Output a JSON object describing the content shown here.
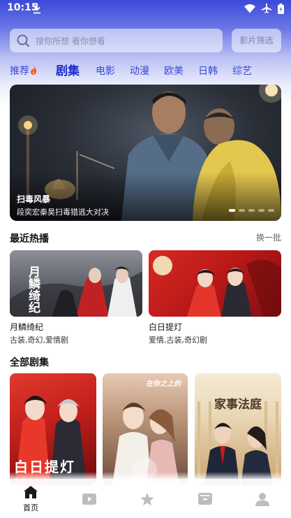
{
  "status_bar": {
    "time": "10:15"
  },
  "search": {
    "placeholder": "搜你所想 看你想看",
    "filter_label": "影片筛选"
  },
  "tabs": [
    {
      "label": "推荐"
    },
    {
      "label": "剧集"
    },
    {
      "label": "电影"
    },
    {
      "label": "动漫"
    },
    {
      "label": "欧美"
    },
    {
      "label": "日韩"
    },
    {
      "label": "综艺"
    }
  ],
  "active_tab": "剧集",
  "banner": {
    "title": "扫毒风暴",
    "subtitle": "段奕宏秦昊扫毒猎逃大对决",
    "page_count": 5,
    "current_page": 1
  },
  "recent": {
    "title": "最近热播",
    "action": "换一批",
    "items": [
      {
        "title": "月鳞绮纪",
        "tags": "古装,奇幻,爱情剧",
        "poster_text": "月鳞绮纪"
      },
      {
        "title": "白日提灯",
        "tags": "爱情,古装,奇幻剧"
      }
    ]
  },
  "all_series": {
    "title": "全部剧集",
    "items": [
      {
        "poster_text": "白日提灯"
      },
      {
        "poster_text": "在你之上的"
      },
      {
        "poster_text": "家事法庭"
      }
    ]
  },
  "bottom_nav": [
    {
      "label": "首页",
      "icon": "home-icon",
      "active": true
    },
    {
      "label": "",
      "icon": "video-icon"
    },
    {
      "label": "",
      "icon": "star-icon"
    },
    {
      "label": "",
      "icon": "folder-icon"
    },
    {
      "label": "",
      "icon": "user-icon"
    }
  ],
  "colors": {
    "accent": "#1c2cc8",
    "tab": "#3a48d6",
    "header_top": "#3b49d9"
  }
}
